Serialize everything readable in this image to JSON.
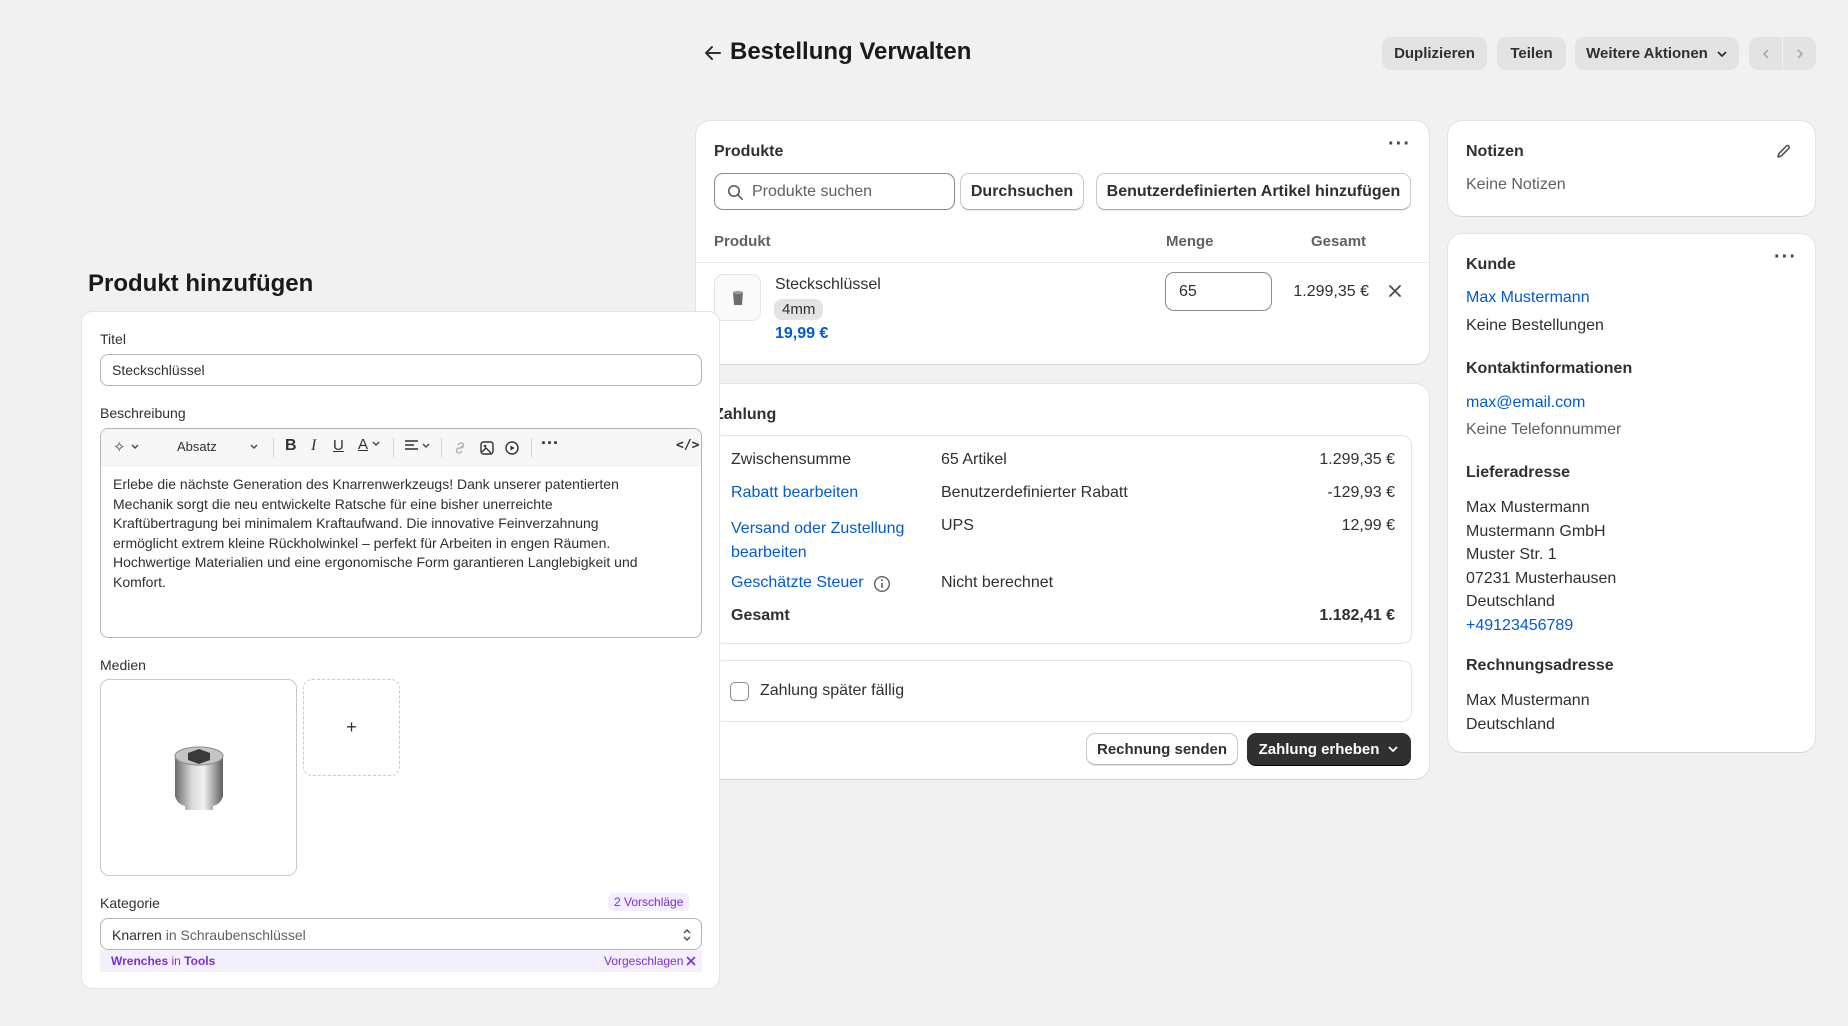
{
  "header": {
    "title": "Bestellung Verwalten",
    "duplicate_label": "Duplizieren",
    "share_label": "Teilen",
    "more_actions_label": "Weitere Aktionen"
  },
  "products": {
    "title": "Produkte",
    "search_placeholder": "Produkte suchen",
    "browse_label": "Durchsuchen",
    "custom_item_label": "Benutzerdefinierten Artikel hinzufügen",
    "columns": {
      "product": "Produkt",
      "quantity": "Menge",
      "total": "Gesamt"
    },
    "item": {
      "name": "Steckschlüssel",
      "variant": "4mm",
      "price": "19,99 €",
      "quantity": "65",
      "total": "1.299,35 €"
    }
  },
  "payment": {
    "title": "Zahlung",
    "rows": {
      "subtotal": {
        "label": "Zwischensumme",
        "desc": "65 Artikel",
        "amount": "1.299,35 €"
      },
      "discount": {
        "label": "Rabatt bearbeiten",
        "desc": "Benutzerdefinierter Rabatt",
        "amount": "-129,93 €"
      },
      "shipping": {
        "label_line1": "Versand oder Zustellung",
        "label_line2": "bearbeiten",
        "desc": "UPS",
        "amount": "12,99 €"
      },
      "tax": {
        "label": "Geschätzte Steuer",
        "desc": "Nicht berechnet"
      },
      "total": {
        "label": "Gesamt",
        "amount": "1.182,41 €"
      }
    },
    "pay_later_label": "Zahlung später fällig",
    "send_invoice_label": "Rechnung senden",
    "collect_payment_label": "Zahlung erheben"
  },
  "notes": {
    "title": "Notizen",
    "empty": "Keine Notizen"
  },
  "customer": {
    "title": "Kunde",
    "name": "Max Mustermann",
    "orders": "Keine Bestellungen",
    "contact_title": "Kontaktinformationen",
    "email": "max@email.com",
    "phone": "Keine Telefonnummer",
    "shipping_title": "Lieferadresse",
    "shipping_lines": [
      "Max Mustermann",
      "Mustermann GmbH",
      "Muster Str. 1",
      "07231 Musterhausen",
      "Deutschland"
    ],
    "shipping_phone": "+49123456789",
    "billing_title": "Rechnungsadresse",
    "billing_lines": [
      "Max Mustermann",
      "Deutschland"
    ]
  },
  "add_product": {
    "heading": "Produkt hinzufügen",
    "title_label": "Titel",
    "title_value": "Steckschlüssel",
    "description_label": "Beschreibung",
    "paragraph_select": "Absatz",
    "description_lines": [
      "Erlebe die nächste Generation des Knarrenwerkzeugs! Dank unserer patentierten",
      "Mechanik sorgt die neu entwickelte Ratsche für eine bisher unerreichte",
      "Kraftübertragung bei minimalem Kraftaufwand. Die innovative Feinverzahnung",
      "ermöglicht extrem kleine Rückholwinkel – perfekt für Arbeiten in engen Räumen.",
      "Hochwertige Materialien und eine ergonomische Form garantieren Langlebigkeit und",
      "Komfort."
    ],
    "media_label": "Medien",
    "add_media_symbol": "+",
    "category_label": "Kategorie",
    "suggestions_badge": "2 Vorschläge",
    "category_value": "Knarren",
    "category_in": "in",
    "category_parent": "Schraubenschlüssel",
    "suggestion_value": "Wrenches",
    "suggestion_in": "in",
    "suggestion_parent": "Tools",
    "suggested_label": "Vorgeschlagen"
  },
  "colors": {
    "accent_link": "#005bd3",
    "primary_button": "#303030",
    "suggestion_purple": "#7a2fd8"
  },
  "icons": [
    "back-arrow-icon",
    "chevron-down-icon",
    "chevron-left-icon",
    "chevron-right-icon",
    "more-horizontal-icon",
    "search-icon",
    "close-icon",
    "info-icon",
    "edit-pencil-icon",
    "checkbox-icon"
  ]
}
